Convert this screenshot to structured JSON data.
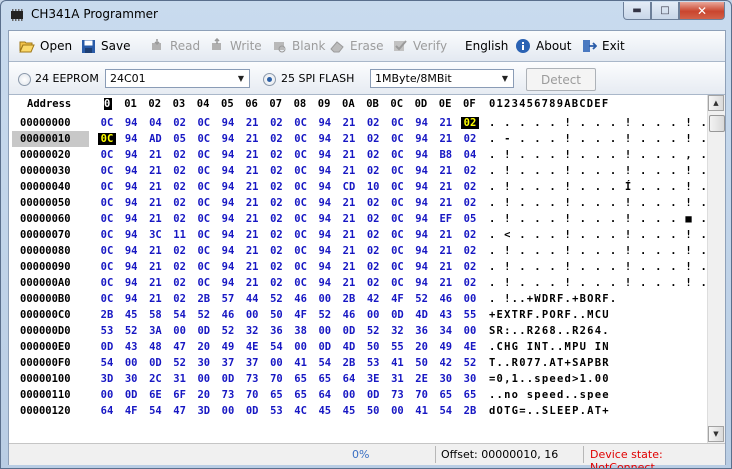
{
  "window": {
    "title": "CH341A Programmer"
  },
  "toolbar": {
    "open": "Open",
    "save": "Save",
    "read": "Read",
    "write": "Write",
    "blank": "Blank",
    "erase": "Erase",
    "verify": "Verify",
    "language": "English",
    "about": "About",
    "exit": "Exit"
  },
  "options": {
    "eeprom_label": "24 EEPROM",
    "eeprom_value": "24C01",
    "spi_label": "25 SPI FLASH",
    "spi_value": "1MByte/8MBit",
    "detect": "Detect"
  },
  "hex": {
    "address_header": "Address",
    "col_headers": [
      "0",
      "01",
      "02",
      "03",
      "04",
      "05",
      "06",
      "07",
      "08",
      "09",
      "0A",
      "0B",
      "0C",
      "0D",
      "0E",
      "0F"
    ],
    "ascii_header": "0123456789ABCDEF",
    "rows": [
      {
        "addr": "00000000",
        "bytes": [
          "0C",
          "94",
          "04",
          "02",
          "0C",
          "94",
          "21",
          "02",
          "0C",
          "94",
          "21",
          "02",
          "0C",
          "94",
          "21",
          "02"
        ],
        "ascii": ". . . . . ! . . . ! . . . ! . ."
      },
      {
        "addr": "00000010",
        "bytes": [
          "0C",
          "94",
          "AD",
          "05",
          "0C",
          "94",
          "21",
          "02",
          "0C",
          "94",
          "21",
          "02",
          "0C",
          "94",
          "21",
          "02"
        ],
        "ascii": ". - . . . ! . . . ! . . . ! . ."
      },
      {
        "addr": "00000020",
        "bytes": [
          "0C",
          "94",
          "21",
          "02",
          "0C",
          "94",
          "21",
          "02",
          "0C",
          "94",
          "21",
          "02",
          "0C",
          "94",
          "B8",
          "04"
        ],
        "ascii": ". ! . . . ! . . . ! . . . , . ."
      },
      {
        "addr": "00000030",
        "bytes": [
          "0C",
          "94",
          "21",
          "02",
          "0C",
          "94",
          "21",
          "02",
          "0C",
          "94",
          "21",
          "02",
          "0C",
          "94",
          "21",
          "02"
        ],
        "ascii": ". ! . . . ! . . . ! . . . ! . ."
      },
      {
        "addr": "00000040",
        "bytes": [
          "0C",
          "94",
          "21",
          "02",
          "0C",
          "94",
          "21",
          "02",
          "0C",
          "94",
          "CD",
          "10",
          "0C",
          "94",
          "21",
          "02"
        ],
        "ascii": ". ! . . . ! . . . Í . . . ! . ."
      },
      {
        "addr": "00000050",
        "bytes": [
          "0C",
          "94",
          "21",
          "02",
          "0C",
          "94",
          "21",
          "02",
          "0C",
          "94",
          "21",
          "02",
          "0C",
          "94",
          "21",
          "02"
        ],
        "ascii": ". ! . . . ! . . . ! . . . ! . ."
      },
      {
        "addr": "00000060",
        "bytes": [
          "0C",
          "94",
          "21",
          "02",
          "0C",
          "94",
          "21",
          "02",
          "0C",
          "94",
          "21",
          "02",
          "0C",
          "94",
          "EF",
          "05"
        ],
        "ascii": ". ! . . . ! . . . ! . . . ■ . ."
      },
      {
        "addr": "00000070",
        "bytes": [
          "0C",
          "94",
          "3C",
          "11",
          "0C",
          "94",
          "21",
          "02",
          "0C",
          "94",
          "21",
          "02",
          "0C",
          "94",
          "21",
          "02"
        ],
        "ascii": ". < . . . ! . . . ! . . . ! . ."
      },
      {
        "addr": "00000080",
        "bytes": [
          "0C",
          "94",
          "21",
          "02",
          "0C",
          "94",
          "21",
          "02",
          "0C",
          "94",
          "21",
          "02",
          "0C",
          "94",
          "21",
          "02"
        ],
        "ascii": ". ! . . . ! . . . ! . . . ! . ."
      },
      {
        "addr": "00000090",
        "bytes": [
          "0C",
          "94",
          "21",
          "02",
          "0C",
          "94",
          "21",
          "02",
          "0C",
          "94",
          "21",
          "02",
          "0C",
          "94",
          "21",
          "02"
        ],
        "ascii": ". ! . . . ! . . . ! . . . ! . ."
      },
      {
        "addr": "000000A0",
        "bytes": [
          "0C",
          "94",
          "21",
          "02",
          "0C",
          "94",
          "21",
          "02",
          "0C",
          "94",
          "21",
          "02",
          "0C",
          "94",
          "21",
          "02"
        ],
        "ascii": ". ! . . . ! . . . ! . . . ! . ."
      },
      {
        "addr": "000000B0",
        "bytes": [
          "0C",
          "94",
          "21",
          "02",
          "2B",
          "57",
          "44",
          "52",
          "46",
          "00",
          "2B",
          "42",
          "4F",
          "52",
          "46",
          "00"
        ],
        "ascii": ". !..+WDRF.+BORF."
      },
      {
        "addr": "000000C0",
        "bytes": [
          "2B",
          "45",
          "58",
          "54",
          "52",
          "46",
          "00",
          "50",
          "4F",
          "52",
          "46",
          "00",
          "0D",
          "4D",
          "43",
          "55"
        ],
        "ascii": "+EXTRF.PORF..MCU"
      },
      {
        "addr": "000000D0",
        "bytes": [
          "53",
          "52",
          "3A",
          "00",
          "0D",
          "52",
          "32",
          "36",
          "38",
          "00",
          "0D",
          "52",
          "32",
          "36",
          "34",
          "00"
        ],
        "ascii": "SR:..R268..R264."
      },
      {
        "addr": "000000E0",
        "bytes": [
          "0D",
          "43",
          "48",
          "47",
          "20",
          "49",
          "4E",
          "54",
          "00",
          "0D",
          "4D",
          "50",
          "55",
          "20",
          "49",
          "4E"
        ],
        "ascii": ".CHG INT..MPU IN"
      },
      {
        "addr": "000000F0",
        "bytes": [
          "54",
          "00",
          "0D",
          "52",
          "30",
          "37",
          "37",
          "00",
          "41",
          "54",
          "2B",
          "53",
          "41",
          "50",
          "42",
          "52"
        ],
        "ascii": "T..R077.AT+SAPBR"
      },
      {
        "addr": "00000100",
        "bytes": [
          "3D",
          "30",
          "2C",
          "31",
          "00",
          "0D",
          "73",
          "70",
          "65",
          "65",
          "64",
          "3E",
          "31",
          "2E",
          "30",
          "30"
        ],
        "ascii": "=0,1..speed>1.00"
      },
      {
        "addr": "00000110",
        "bytes": [
          "00",
          "0D",
          "6E",
          "6F",
          "20",
          "73",
          "70",
          "65",
          "65",
          "64",
          "00",
          "0D",
          "73",
          "70",
          "65",
          "65"
        ],
        "ascii": "..no speed..spee"
      },
      {
        "addr": "00000120",
        "bytes": [
          "64",
          "4F",
          "54",
          "47",
          "3D",
          "00",
          "0D",
          "53",
          "4C",
          "45",
          "45",
          "50",
          "00",
          "41",
          "54",
          "2B"
        ],
        "ascii": "dOTG=..SLEEP.AT+"
      }
    ],
    "selected_address": "00000010",
    "selected_col": "0"
  },
  "status": {
    "progress": "0%",
    "progress_fraction": 0,
    "offset": "Offset: 00000010, 16",
    "device": "Device state: NotConnect."
  }
}
